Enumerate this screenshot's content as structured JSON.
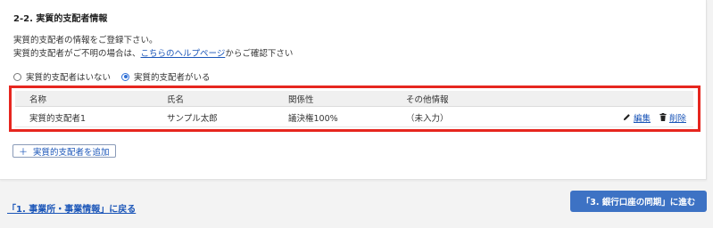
{
  "section": {
    "title": "2-2. 実質的支配者情報",
    "desc_line1": "実質的支配者の情報をご登録下さい。",
    "desc_line2_prefix": "実質的支配者がご不明の場合は、",
    "help_link": "こちらのヘルプページ",
    "desc_line2_suffix": "からご確認下さい"
  },
  "radio": {
    "none_label": "実質的支配者はいない",
    "exists_label": "実質的支配者がいる",
    "selected": "exists"
  },
  "table": {
    "headers": [
      "名称",
      "氏名",
      "関係性",
      "その他情報"
    ],
    "rows": [
      {
        "name": "実質的支配者1",
        "person": "サンプル太郎",
        "relation": "議決権100%",
        "other": "（未入力）",
        "edit_label": "編集",
        "delete_label": "削除"
      }
    ]
  },
  "add_button": {
    "icon": "plus-icon",
    "label": "実質的支配者を追加"
  },
  "footer": {
    "back_link": "「1. 事業所・事業情報」に戻る",
    "next_button": "「3. 銀行口座の同期」に進む"
  },
  "colors": {
    "accent": "#3d72c4",
    "link": "#1a55b8",
    "highlight_border": "#e6261f"
  }
}
